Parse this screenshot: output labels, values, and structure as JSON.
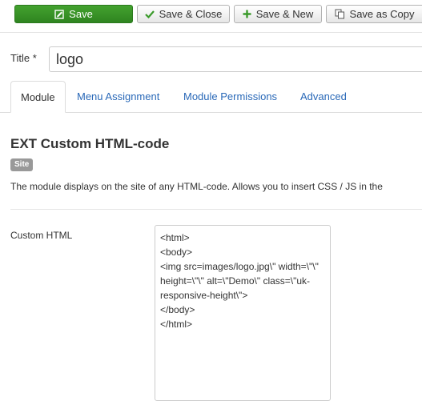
{
  "toolbar": {
    "save_label": "Save",
    "save_close_label": "Save & Close",
    "save_new_label": "Save & New",
    "save_copy_label": "Save as Copy"
  },
  "icons": {
    "save": "save-icon",
    "save_close": "check-icon",
    "save_new": "plus-icon",
    "save_copy": "copy-icon"
  },
  "colors": {
    "primary_button": "#3a9a2a",
    "link": "#2a69b8",
    "badge": "#999999"
  },
  "form": {
    "title_label": "Title *",
    "title_value": "logo"
  },
  "tabs": [
    {
      "label": "Module",
      "active": true
    },
    {
      "label": "Menu Assignment",
      "active": false
    },
    {
      "label": "Module Permissions",
      "active": false
    },
    {
      "label": "Advanced",
      "active": false
    }
  ],
  "module": {
    "title": "EXT Custom HTML-code",
    "badge": "Site",
    "description": "The module displays on the site of any HTML-code. Allows you to insert CSS / JS in the"
  },
  "custom_html": {
    "label": "Custom HTML",
    "value": "<html>\n<body>\n<img src=images/logo.jpg\\\" width=\\\"\\\" height=\\\"\\\" alt=\\\"Demo\\\" class=\\\"uk-responsive-height\\\">\n</body>\n</html>"
  }
}
